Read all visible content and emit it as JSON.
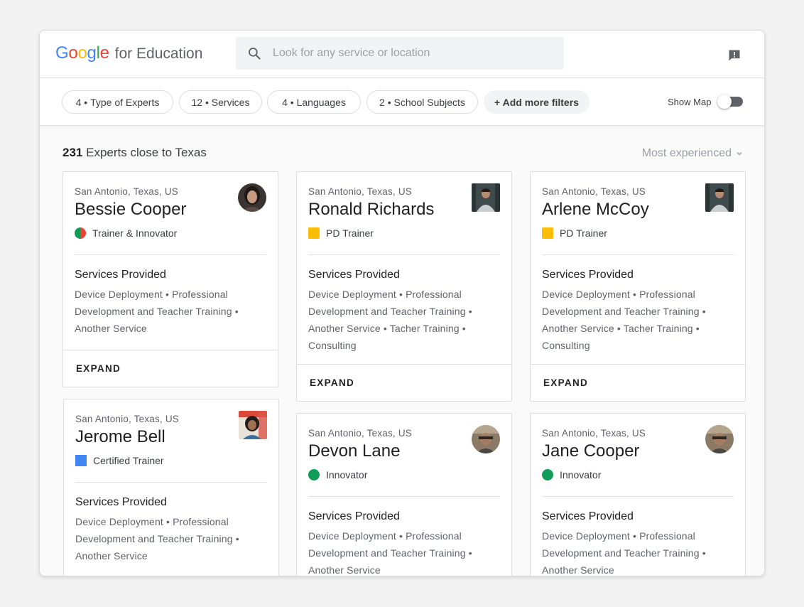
{
  "header": {
    "logo_text": "Google",
    "logo_sub": "for Education",
    "search_placeholder": "Look for any service or location"
  },
  "filters": [
    {
      "count": "4",
      "label": "Type of Experts"
    },
    {
      "count": "12",
      "label": "Services"
    },
    {
      "count": "4",
      "label": "Languages"
    },
    {
      "count": "2",
      "label": "School Subjects"
    }
  ],
  "add_filters_label": "+ Add more filters",
  "show_map_label": "Show Map",
  "show_map_on": false,
  "results": {
    "count": "231",
    "label": "Experts close to Texas",
    "sort_label": "Most experienced"
  },
  "colors": {
    "google_blue": "#4285f4",
    "google_red": "#ea4335",
    "google_yellow": "#fbbc05",
    "google_green": "#34a853",
    "trainer_yellow": "#fbbc04",
    "innovator_green": "#0f9d58",
    "certified_blue": "#4285f4"
  },
  "services_heading": "Services Provided",
  "expand_label": "EXPAND",
  "experts": [
    {
      "location": "San Antonio, Texas, US",
      "name": "Bessie Cooper",
      "role": "Trainer & Innovator",
      "role_icon": "split-circle",
      "services": "Device Deployment • Professional Development and Teacher Training • Another Service"
    },
    {
      "location": "San Antonio, Texas, US",
      "name": "Ronald Richards",
      "role": "PD Trainer",
      "role_icon": "yellow-square",
      "services": "Device Deployment • Professional Development and Teacher Training • Another Service • Tacher Training • Consulting"
    },
    {
      "location": "San Antonio, Texas, US",
      "name": "Arlene McCoy",
      "role": "PD Trainer",
      "role_icon": "yellow-square",
      "services": "Device Deployment • Professional Development and Teacher Training • Another Service • Tacher Training • Consulting"
    },
    {
      "location": "San Antonio, Texas, US",
      "name": "Jerome Bell",
      "role": "Certified Trainer",
      "role_icon": "blue-square",
      "services": "Device Deployment • Professional Development and Teacher Training • Another Service"
    },
    {
      "location": "San Antonio, Texas, US",
      "name": "Devon Lane",
      "role": "Innovator",
      "role_icon": "green-circle",
      "services": "Device Deployment • Professional Development and Teacher Training • Another Service"
    },
    {
      "location": "San Antonio, Texas, US",
      "name": "Jane Cooper",
      "role": "Innovator",
      "role_icon": "green-circle",
      "services": "Device Deployment • Professional Development and Teacher Training • Another Service"
    }
  ]
}
